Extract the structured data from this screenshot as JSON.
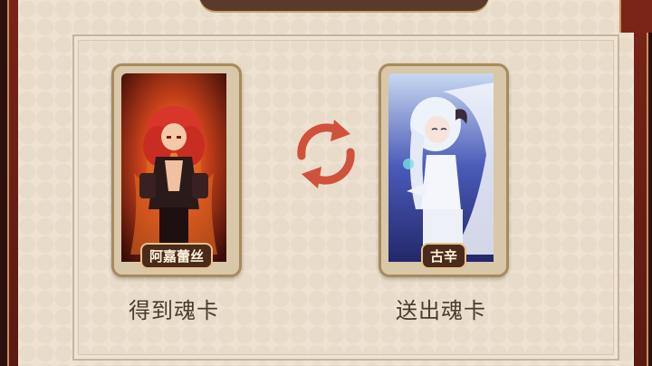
{
  "dialog": {
    "title": "",
    "obtain_caption": "得到魂卡",
    "send_caption": "送出魂卡"
  },
  "cards": {
    "obtain": {
      "name": "阿嘉蕾丝",
      "theme_color": "#c23a1c"
    },
    "send": {
      "name": "古辛",
      "theme_color": "#2a3a9a"
    }
  },
  "icons": {
    "swap": "swap-cycle-icon"
  },
  "colors": {
    "frame_red": "#7a2418",
    "panel": "#eee3d3",
    "swap_arrow": "#d0523c",
    "caption": "#4a3a30"
  }
}
